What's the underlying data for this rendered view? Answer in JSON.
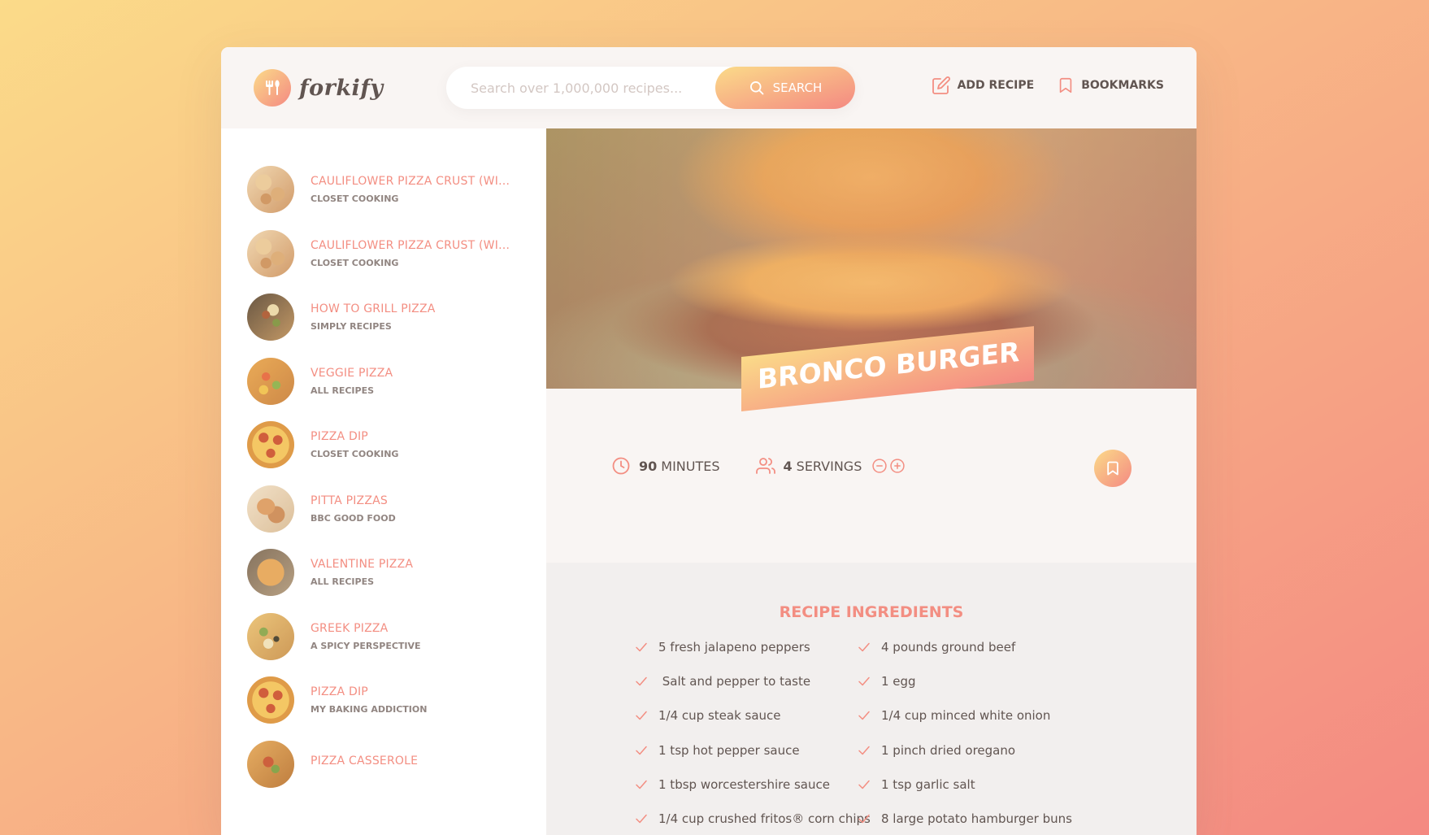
{
  "brand": {
    "name": "forkify"
  },
  "colors": {
    "accent": "#f38e82",
    "grad_start": "#fbdb89",
    "grad_end": "#f48982",
    "text": "#615551"
  },
  "search": {
    "placeholder": "Search over 1,000,000 recipes...",
    "button_label": "Search"
  },
  "nav": {
    "add_recipe": "Add recipe",
    "bookmarks": "Bookmarks"
  },
  "results": [
    {
      "title": "Cauliflower Pizza Crust (with BBQ Chicken Pizza)",
      "display_title": "CAULIFLOWER PIZZA CRUST (WIT...",
      "publisher": "Closet Cooking",
      "thumb": "pizza-slices"
    },
    {
      "title": "Cauliflower Pizza Crust (with BBQ Chicken Pizza)",
      "display_title": "CAULIFLOWER PIZZA CRUST (WIT...",
      "publisher": "Closet Cooking",
      "thumb": "pizza-slices"
    },
    {
      "title": "How to Grill Pizza",
      "display_title": "HOW TO GRILL PIZZA",
      "publisher": "Simply Recipes",
      "thumb": "grilled-pizza"
    },
    {
      "title": "Veggie Pizza",
      "display_title": "VEGGIE PIZZA",
      "publisher": "All Recipes",
      "thumb": "veggie-pizza"
    },
    {
      "title": "Pizza Dip",
      "display_title": "PIZZA DIP",
      "publisher": "Closet Cooking",
      "thumb": "pepperoni-pizza"
    },
    {
      "title": "Pitta Pizzas",
      "display_title": "PITTA PIZZAS",
      "publisher": "BBC Good Food",
      "thumb": "pitta"
    },
    {
      "title": "Valentine Pizza",
      "display_title": "VALENTINE PIZZA",
      "publisher": "All Recipes",
      "thumb": "valentine"
    },
    {
      "title": "Greek Pizza",
      "display_title": "GREEK PIZZA",
      "publisher": "A Spicy Perspective",
      "thumb": "greek"
    },
    {
      "title": "Pizza Dip",
      "display_title": "PIZZA DIP",
      "publisher": "My Baking Addiction",
      "thumb": "pepperoni-pizza"
    },
    {
      "title": "Pizza Casserole",
      "display_title": "PIZZA CASSEROLE",
      "publisher": "",
      "thumb": "casserole"
    }
  ],
  "recipe": {
    "title": "Bronco Burger",
    "cooking_time": "90",
    "time_unit": "minutes",
    "servings": "4",
    "servings_unit": "servings",
    "ingredients_heading": "Recipe ingredients",
    "ingredients": [
      "5 fresh jalapeno peppers",
      "4 pounds ground beef",
      " Salt and pepper to taste",
      "1 egg",
      "1/4 cup steak sauce",
      "1/4 cup minced white onion",
      "1 tsp hot pepper sauce",
      "1 pinch dried oregano",
      "1 tbsp worcestershire sauce",
      "1 tsp garlic salt",
      "1/4 cup crushed fritos® corn chips",
      "8 large potato hamburger buns"
    ]
  },
  "icons": {
    "search": "search-icon",
    "add": "edit-icon",
    "bookmark": "bookmark-icon",
    "clock": "clock-icon",
    "users": "users-icon",
    "minus": "minus-circle-icon",
    "plus": "plus-circle-icon",
    "check": "check-icon"
  }
}
